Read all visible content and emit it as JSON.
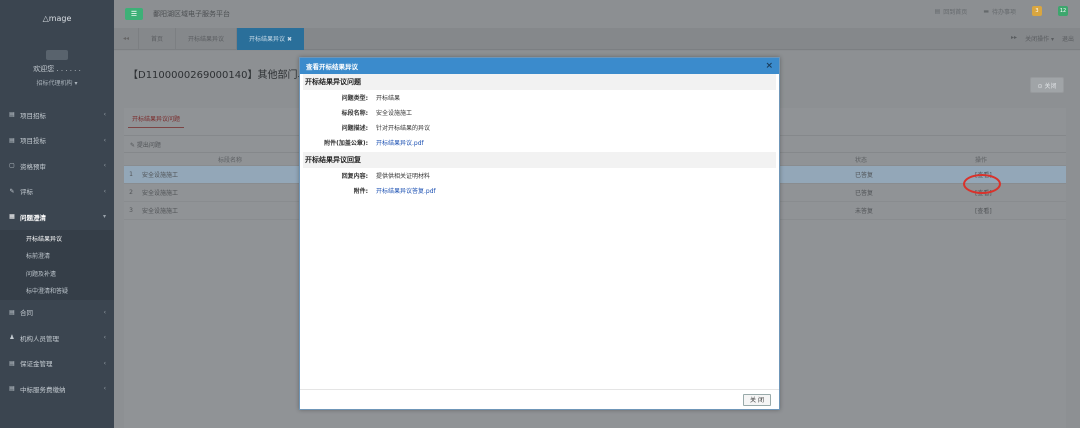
{
  "sidebar": {
    "logo": "△mage",
    "user_name": "欢迎您 . . . . . .",
    "user_role": "招标代理机构 ▾",
    "items": [
      {
        "label": "项目招标",
        "icon": "▤"
      },
      {
        "label": "项目投标",
        "icon": "▤"
      },
      {
        "label": "资格预审",
        "icon": "▢"
      },
      {
        "label": "评标",
        "icon": "✎"
      },
      {
        "label": "问题澄清",
        "icon": "▦"
      }
    ],
    "subitems": [
      {
        "label": "开标结果异议"
      },
      {
        "label": "标前澄清"
      },
      {
        "label": "问题及补遗"
      },
      {
        "label": "标中澄清和答疑"
      }
    ],
    "items_after": [
      {
        "label": "合同",
        "icon": "▤"
      },
      {
        "label": "机构人员管理",
        "icon": "♟"
      },
      {
        "label": "保证金管理",
        "icon": "▤"
      },
      {
        "label": "中标服务费缴纳",
        "icon": "▤"
      }
    ]
  },
  "topbar": {
    "menu_icon": "☰",
    "title": "鄱阳湖区域电子服务平台",
    "links": [
      "回到首页",
      "待办事项"
    ],
    "badge_a": "3",
    "badge_b": "12"
  },
  "tabs": {
    "items": [
      "首页",
      "开标结果异议",
      "开标结果异议 ✖"
    ],
    "right": [
      "关闭操作 ▾",
      "退出"
    ]
  },
  "page": {
    "title": "【D1100000269000140】其他部门单个",
    "close_label": "⊙ 关闭",
    "panel_tab": "开标结果异议问题",
    "toolbar_label": "✎ 提出问题",
    "columns": [
      "标段名称",
      "状态",
      "操作"
    ],
    "rows": [
      {
        "num": "1",
        "name": "安全设施施工",
        "status": "已答复",
        "op": "[查看]"
      },
      {
        "num": "2",
        "name": "安全设施施工",
        "status": "已答复",
        "op": "[查看]"
      },
      {
        "num": "3",
        "name": "安全设施施工",
        "status": "未答复",
        "op": "[查看]"
      }
    ]
  },
  "modal": {
    "title": "查看开标结果异议",
    "section1": "开标结果异议问题",
    "fields1": [
      {
        "label": "问题类型:",
        "value": "开标结果"
      },
      {
        "label": "标段名称:",
        "value": "安全设施施工"
      },
      {
        "label": "问题描述:",
        "value": "针对开标结果的异议"
      },
      {
        "label": "附件(加盖公章):",
        "value": "开标结果异议.pdf"
      }
    ],
    "section2": "开标结果异议回复",
    "fields2": [
      {
        "label": "回复内容:",
        "value": "提供供相关证明材料"
      },
      {
        "label": "附件:",
        "value": "开标结果异议答复.pdf"
      }
    ],
    "close_label": "关 闭"
  }
}
